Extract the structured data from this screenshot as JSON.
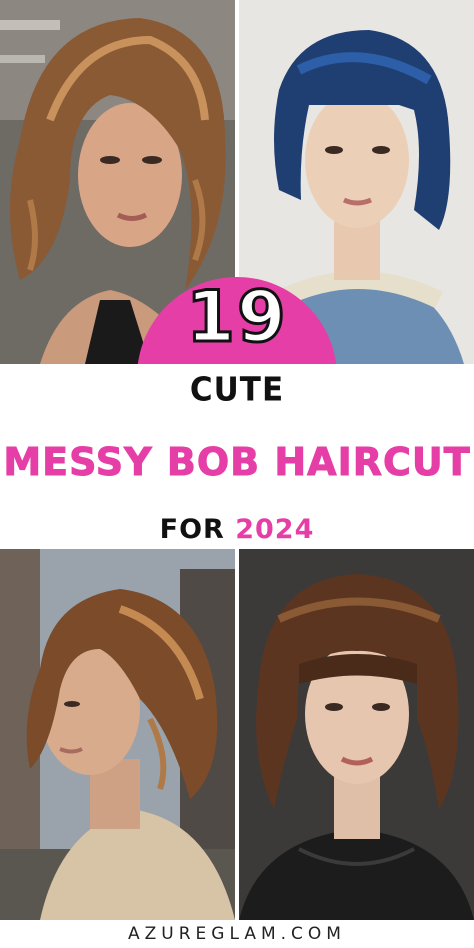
{
  "badge": {
    "number": "19",
    "color": "#e63ea7"
  },
  "title": {
    "line1": "CUTE",
    "line2": "MESSY BOB HAIRCUT",
    "line3_prefix": "FOR",
    "line3_year": "2024"
  },
  "footer": {
    "website": "AZUREGLAM.COM"
  },
  "colors": {
    "accent": "#e63ea7",
    "text": "#111111"
  },
  "photos": [
    {
      "subject": "woman-wavy-highlighted-bob"
    },
    {
      "subject": "woman-blue-blunt-bob-bangs"
    },
    {
      "subject": "woman-shaggy-bob-profile"
    },
    {
      "subject": "woman-bob-with-bangs"
    }
  ]
}
